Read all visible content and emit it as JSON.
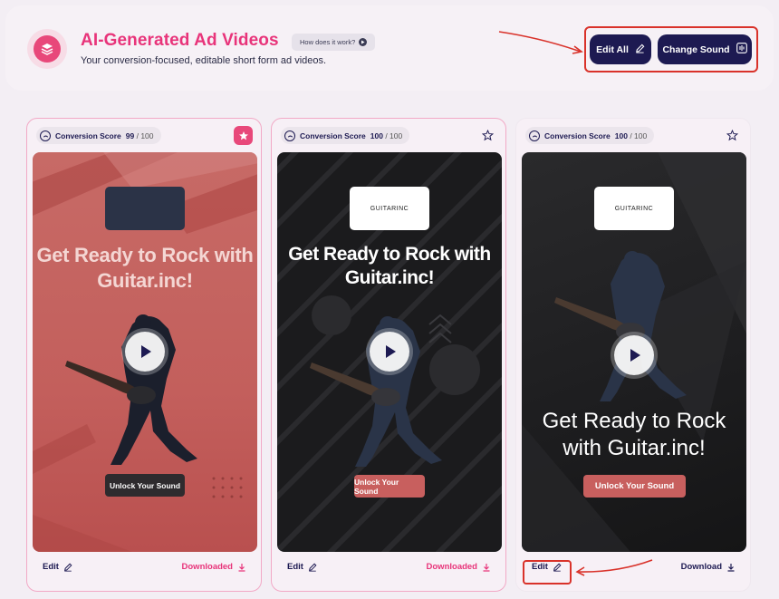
{
  "header": {
    "title": "AI-Generated Ad Videos",
    "subtitle": "Your conversion-focused, editable short form ad videos.",
    "how_label": "How does it work?",
    "edit_all_label": "Edit All",
    "change_sound_label": "Change Sound"
  },
  "cards": [
    {
      "score_label": "Conversion Score",
      "score": "99",
      "score_max": "/ 100",
      "favorited": true,
      "headline": "Get Ready to Rock with Guitar.inc!",
      "cta": "Unlock Your Sound",
      "edit_label": "Edit",
      "download_label": "Downloaded"
    },
    {
      "score_label": "Conversion Score",
      "score": "100",
      "score_max": "/ 100",
      "favorited": false,
      "brand": "GUITARINC",
      "headline": "Get Ready to Rock with Guitar.inc!",
      "cta": "Unlock Your Sound",
      "edit_label": "Edit",
      "download_label": "Downloaded"
    },
    {
      "score_label": "Conversion Score",
      "score": "100",
      "score_max": "/ 100",
      "favorited": false,
      "brand": "GUITARINC",
      "headline": "Get Ready to Rock with Guitar.inc!",
      "cta": "Unlock Your Sound",
      "edit_label": "Edit",
      "download_label": "Download"
    }
  ],
  "colors": {
    "accent": "#e8347a",
    "primary": "#1d1a52",
    "highlight": "#d9322a",
    "cta_red": "#c85f5e"
  },
  "icons": [
    "layers-icon",
    "play-circle-icon",
    "pencil-icon",
    "sound-bars-icon",
    "gauge-icon",
    "star-icon",
    "play-icon",
    "download-icon",
    "arrow-icon"
  ]
}
